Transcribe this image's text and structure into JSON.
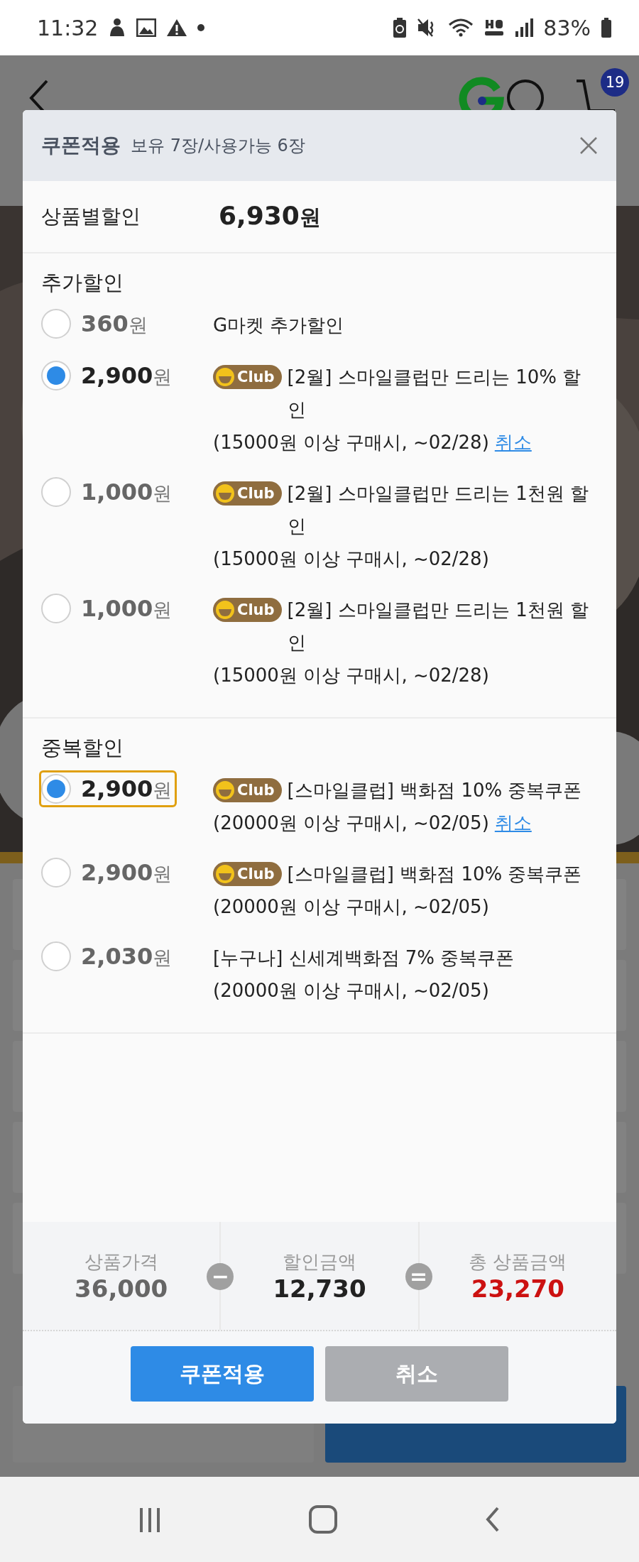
{
  "status_bar": {
    "time": "11:32",
    "battery": "83%"
  },
  "background": {
    "cart_count": "19",
    "bottom_buttons": [
      {
        "kind": "secondary"
      },
      {
        "kind": "primary"
      }
    ]
  },
  "modal": {
    "title": "쿠폰적용",
    "subtitle": "보유 7장/사용가능 6장",
    "product_discount": {
      "label": "상품별할인",
      "amount": "6,930",
      "unit": "원"
    },
    "sections": [
      {
        "title": "추가할인",
        "coupons": [
          {
            "amount": "360",
            "unit": "원",
            "selected": false,
            "focused": false,
            "title": "G마켓 추가할인"
          },
          {
            "amount": "2,900",
            "unit": "원",
            "selected": true,
            "focused": false,
            "badge": "Club",
            "title": "[2월] 스마일클럽만 드리는 10% 할인",
            "condition": "(15000원 이상 구매시, ~02/28)",
            "cancel": "취소"
          },
          {
            "amount": "1,000",
            "unit": "원",
            "selected": false,
            "focused": false,
            "badge": "Club",
            "title": "[2월] 스마일클럽만 드리는 1천원 할인",
            "condition": "(15000원 이상 구매시, ~02/28)"
          },
          {
            "amount": "1,000",
            "unit": "원",
            "selected": false,
            "focused": false,
            "badge": "Club",
            "title": "[2월] 스마일클럽만 드리는 1천원 할인",
            "condition": "(15000원 이상 구매시, ~02/28)"
          }
        ]
      },
      {
        "title": "중복할인",
        "coupons": [
          {
            "amount": "2,900",
            "unit": "원",
            "selected": true,
            "focused": true,
            "badge": "Club",
            "title": "[스마일클럽] 백화점 10% 중복쿠폰",
            "condition": "(20000원 이상 구매시, ~02/05)",
            "cancel": "취소"
          },
          {
            "amount": "2,900",
            "unit": "원",
            "selected": false,
            "focused": false,
            "badge": "Club",
            "title": "[스마일클럽] 백화점 10% 중복쿠폰",
            "condition": "(20000원 이상 구매시, ~02/05)"
          },
          {
            "amount": "2,030",
            "unit": "원",
            "selected": false,
            "focused": false,
            "title": "[누구나] 신세계백화점 7% 중복쿠폰",
            "condition": "(20000원 이상 구매시, ~02/05)"
          }
        ]
      }
    ],
    "summary": [
      {
        "label": "상품가격",
        "value": "36,000",
        "color": "#666666"
      },
      {
        "label": "할인금액",
        "value": "12,730",
        "color": "#222222",
        "operator": "−"
      },
      {
        "label": "총 상품금액",
        "value": "23,270",
        "color": "#cc1111",
        "operator": "="
      }
    ],
    "buttons": [
      {
        "label": "쿠폰적용",
        "kind": "primary"
      },
      {
        "label": "취소",
        "kind": "secondary"
      }
    ]
  }
}
